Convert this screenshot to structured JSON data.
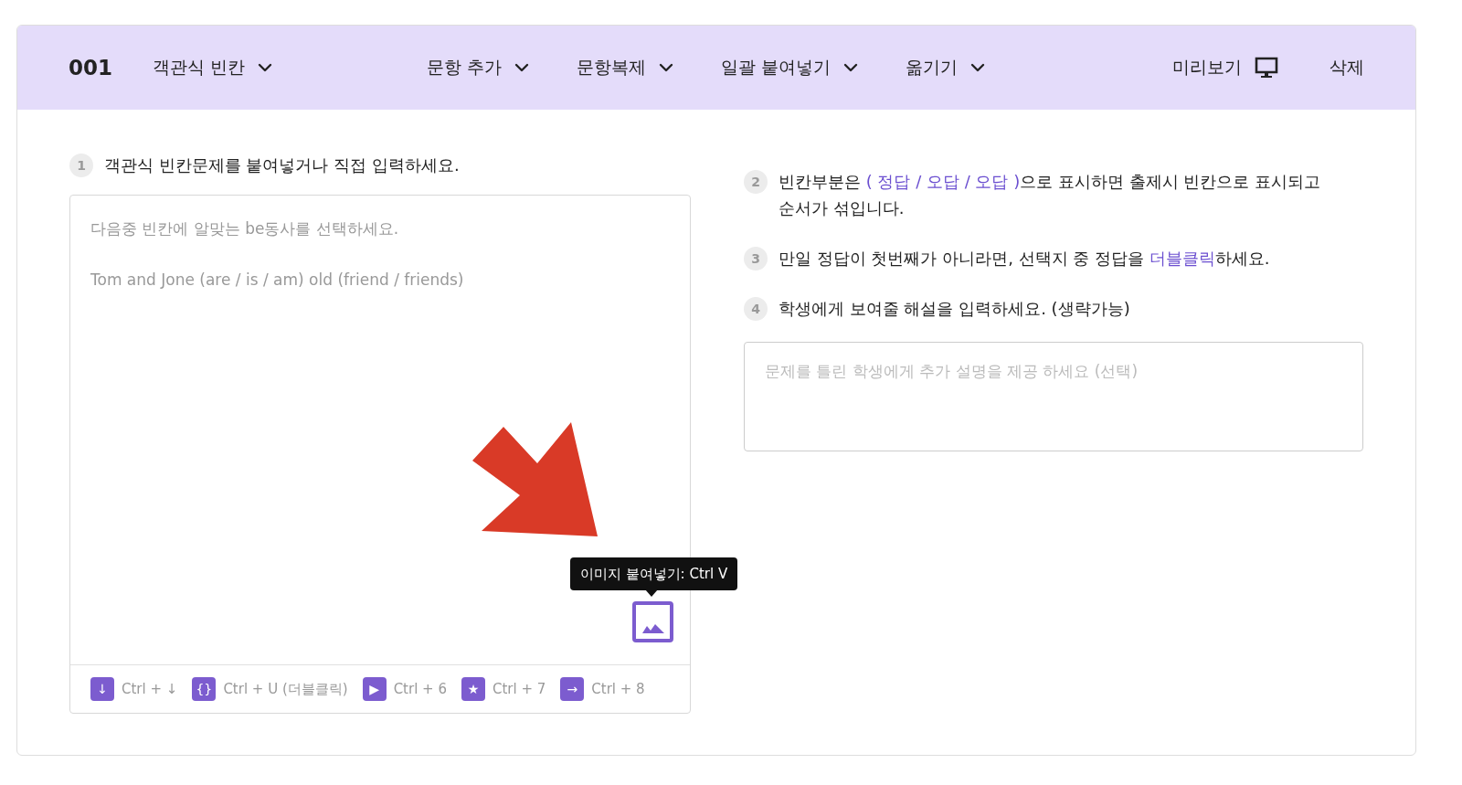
{
  "header": {
    "number": "001",
    "type_menu": {
      "label": "객관식 빈칸"
    },
    "menus": [
      {
        "label": "문항 추가"
      },
      {
        "label": "문항복제"
      },
      {
        "label": "일괄 붙여넣기"
      },
      {
        "label": "옮기기"
      }
    ],
    "preview": {
      "label": "미리보기"
    },
    "delete": {
      "label": "삭제"
    }
  },
  "left": {
    "step": {
      "number": "1",
      "parts": [
        {
          "kind": "plain",
          "text": "객관식 빈칸문제를 붙여넣거나 직접 입력하세요."
        }
      ]
    },
    "editor": {
      "placeholder": "다음중 빈칸에 알맞는 be동사를 선택하세요.\n\nTom and Jone (are / is / am) old (friend / friends)",
      "tooltip": "이미지 붙여넣기: Ctrl V"
    },
    "shortcuts": [
      {
        "icon": "↓",
        "keys": "Ctrl + ↓"
      },
      {
        "icon": "{}",
        "keys": "Ctrl + U (더블클릭)"
      },
      {
        "icon": "▶",
        "keys": "Ctrl + 6"
      },
      {
        "icon": "★",
        "keys": "Ctrl + 7"
      },
      {
        "icon": "→",
        "keys": "Ctrl + 8"
      }
    ]
  },
  "right": {
    "steps": [
      {
        "number": "2",
        "parts": [
          {
            "kind": "plain",
            "text": "빈칸부분은 "
          },
          {
            "kind": "highlight",
            "text": "( 정답 / 오답 / 오답 )"
          },
          {
            "kind": "plain",
            "text": "으로 표시하면 출제시 빈칸으로 표시되고 순서가 섞입니다."
          }
        ]
      },
      {
        "number": "3",
        "parts": [
          {
            "kind": "plain",
            "text": "만일 정답이 첫번째가 아니라면, 선택지 중 정답을 "
          },
          {
            "kind": "highlight",
            "text": "더블클릭"
          },
          {
            "kind": "plain",
            "text": "하세요."
          }
        ]
      },
      {
        "number": "4",
        "parts": [
          {
            "kind": "plain",
            "text": "학생에게 보여줄 해설을 입력하세요. (생략가능)"
          }
        ]
      }
    ],
    "explanation": {
      "placeholder": "문제를 틀린 학생에게 추가 설명을 제공 하세요 (선택)"
    }
  }
}
